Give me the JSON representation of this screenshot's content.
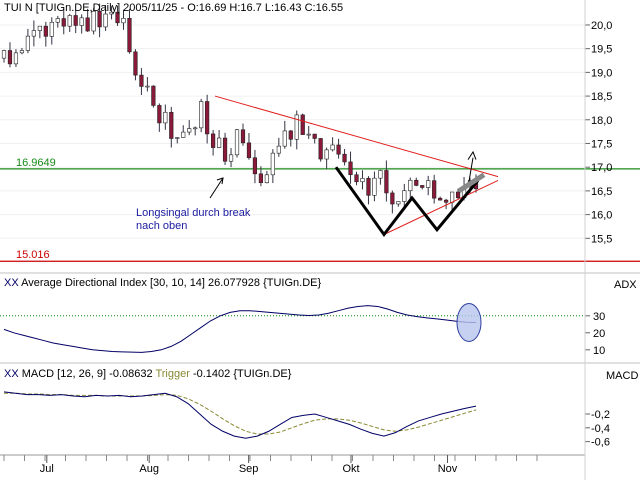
{
  "chart_data": [
    {
      "type": "candlestick",
      "title": "TUI N [TUIGn.DE,Daily] 2005/11/25 - O:16.69 H:16.7 L:16.43 C:16.55",
      "ylim": [
        15.0,
        20.4
      ],
      "yticks": [
        "20,0",
        "19,5",
        "19,0",
        "18,5",
        "18,0",
        "17,5",
        "17,0",
        "16,5",
        "16,0",
        "15,5"
      ],
      "yticks_values": [
        20.0,
        19.5,
        19.0,
        18.5,
        18.0,
        17.5,
        17.0,
        16.5,
        16.0,
        15.5
      ],
      "hlines": [
        {
          "label": "16.9649",
          "value": 16.9649,
          "color": "#1a8a1a"
        },
        {
          "label": "15.016",
          "value": 15.016,
          "color": "#cc0000"
        }
      ],
      "annotation": [
        "Longsingal durch break",
        "nach oben"
      ],
      "colors": {
        "up": "#ffffff",
        "down": "#8b1a3a",
        "wick": "#333344",
        "trendline": "#e02020",
        "pattern": "#000000",
        "arrow": "#000000"
      }
    },
    {
      "type": "line",
      "title": "Average Directional Index [30, 10, 14] 26.077928 {TUIGn.DE}",
      "axis_label": "ADX",
      "ylim": [
        4,
        44
      ],
      "yticks": [
        "30",
        "20",
        "10"
      ],
      "yticks_values": [
        30,
        20,
        10
      ],
      "reference_line": 30,
      "series": [
        {
          "values": [
            22,
            20,
            18.5,
            17,
            15.5,
            14,
            13,
            12,
            11,
            10,
            9.5,
            9,
            8.8,
            8.6,
            8.5,
            9,
            10,
            12,
            15,
            19,
            23,
            27,
            30,
            32,
            33,
            33,
            32.5,
            32,
            31.5,
            31,
            30.5,
            30.2,
            30.5,
            31.5,
            33,
            34.5,
            35.5,
            36,
            35.5,
            34,
            32,
            30.5,
            29.5,
            28.8,
            28.2,
            27.5,
            26.8,
            26.2,
            26.08
          ]
        }
      ],
      "colors": {
        "line": "#000066",
        "reference": "#008800",
        "highlight": "#b8c4ee"
      }
    },
    {
      "type": "line",
      "title": "MACD [12, 26, 9] -0.08632",
      "trigger_label": "Trigger",
      "trigger_value": "-0.1402",
      "symbol": "{TUIGn.DE}",
      "axis_label": "MACD",
      "ylim": [
        -0.75,
        0.35
      ],
      "yticks": [
        "-0,2",
        "-0,4",
        "-0,6"
      ],
      "yticks_values": [
        -0.2,
        -0.4,
        -0.6
      ],
      "series": [
        {
          "name": "MACD",
          "values": [
            0.12,
            0.1,
            0.08,
            0.08,
            0.07,
            0.08,
            0.06,
            0.05,
            0.07,
            0.06,
            0.07,
            0.05,
            0.06,
            0.08,
            0.1,
            0.05,
            -0.05,
            -0.2,
            -0.35,
            -0.45,
            -0.52,
            -0.55,
            -0.52,
            -0.45,
            -0.35,
            -0.25,
            -0.22,
            -0.2,
            -0.25,
            -0.3,
            -0.35,
            -0.42,
            -0.48,
            -0.52,
            -0.47,
            -0.38,
            -0.3,
            -0.25,
            -0.2,
            -0.16,
            -0.12,
            -0.086
          ]
        },
        {
          "name": "Trigger",
          "values": [
            0.1,
            0.1,
            0.09,
            0.09,
            0.08,
            0.08,
            0.07,
            0.07,
            0.07,
            0.06,
            0.06,
            0.06,
            0.06,
            0.07,
            0.08,
            0.07,
            0.02,
            -0.06,
            -0.16,
            -0.27,
            -0.37,
            -0.45,
            -0.49,
            -0.49,
            -0.46,
            -0.4,
            -0.34,
            -0.29,
            -0.27,
            -0.27,
            -0.29,
            -0.33,
            -0.38,
            -0.43,
            -0.45,
            -0.43,
            -0.39,
            -0.34,
            -0.29,
            -0.24,
            -0.19,
            -0.14
          ]
        }
      ],
      "colors": {
        "macd": "#000066",
        "trigger": "#888833"
      }
    }
  ],
  "x_axis": {
    "ticks": [
      {
        "label": "Jul",
        "pos": 0.08
      },
      {
        "label": "Aug",
        "pos": 0.255
      },
      {
        "label": "Sep",
        "pos": 0.425
      },
      {
        "label": "Okt",
        "pos": 0.6
      },
      {
        "label": "Nov",
        "pos": 0.765
      }
    ]
  }
}
